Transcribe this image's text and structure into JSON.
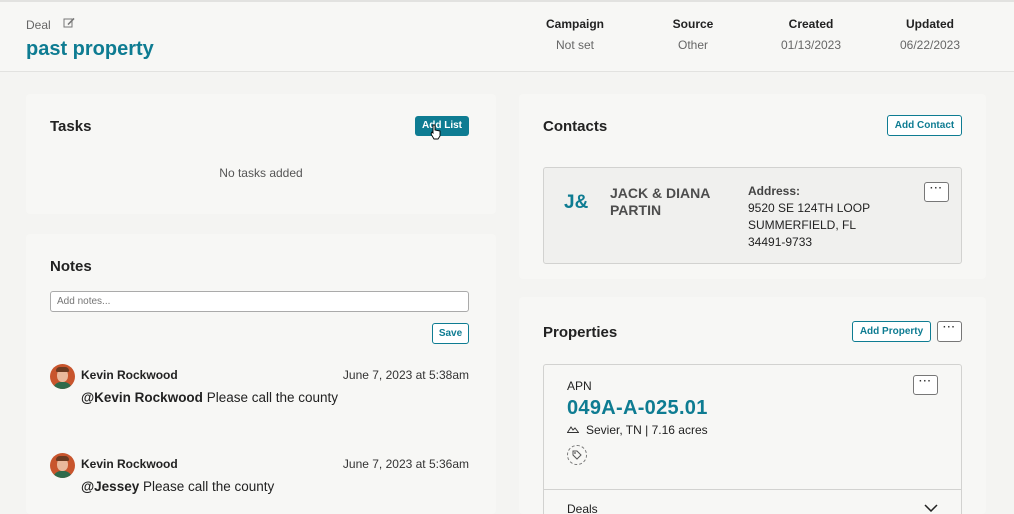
{
  "header": {
    "deal_label": "Deal",
    "title": "past property",
    "meta": [
      {
        "key": "Campaign",
        "value": "Not set"
      },
      {
        "key": "Source",
        "value": "Other"
      },
      {
        "key": "Created",
        "value": "01/13/2023"
      },
      {
        "key": "Updated",
        "value": "06/22/2023"
      }
    ]
  },
  "tasks": {
    "title": "Tasks",
    "add_button": "Add List",
    "empty_text": "No tasks added"
  },
  "notes": {
    "title": "Notes",
    "placeholder": "Add notes...",
    "save_button": "Save",
    "items": [
      {
        "author": "Kevin Rockwood",
        "time": "June 7, 2023 at 5:38am",
        "mention": "@Kevin Rockwood",
        "text": " Please call the county"
      },
      {
        "author": "Kevin Rockwood",
        "time": "June 7, 2023 at 5:36am",
        "mention": "@Jessey",
        "text": " Please call the county"
      }
    ]
  },
  "contacts": {
    "title": "Contacts",
    "add_button": "Add Contact",
    "contact": {
      "initials": "J&",
      "name": "JACK & DIANA PARTIN",
      "address_label": "Address:",
      "address_lines": [
        "9520 SE 124TH LOOP",
        "SUMMERFIELD, FL",
        "34491-9733"
      ]
    },
    "more_label": "···"
  },
  "properties": {
    "title": "Properties",
    "add_button": "Add Property",
    "more_label": "···",
    "item": {
      "apn_label": "APN",
      "apn": "049A-A-025.01",
      "location": "Sevier, TN | 7.16 acres",
      "more_label": "···",
      "deals_label": "Deals"
    }
  },
  "colors": {
    "accent": "#0e7c92",
    "background": "#f4f4f2",
    "card": "#f7f7f5"
  }
}
